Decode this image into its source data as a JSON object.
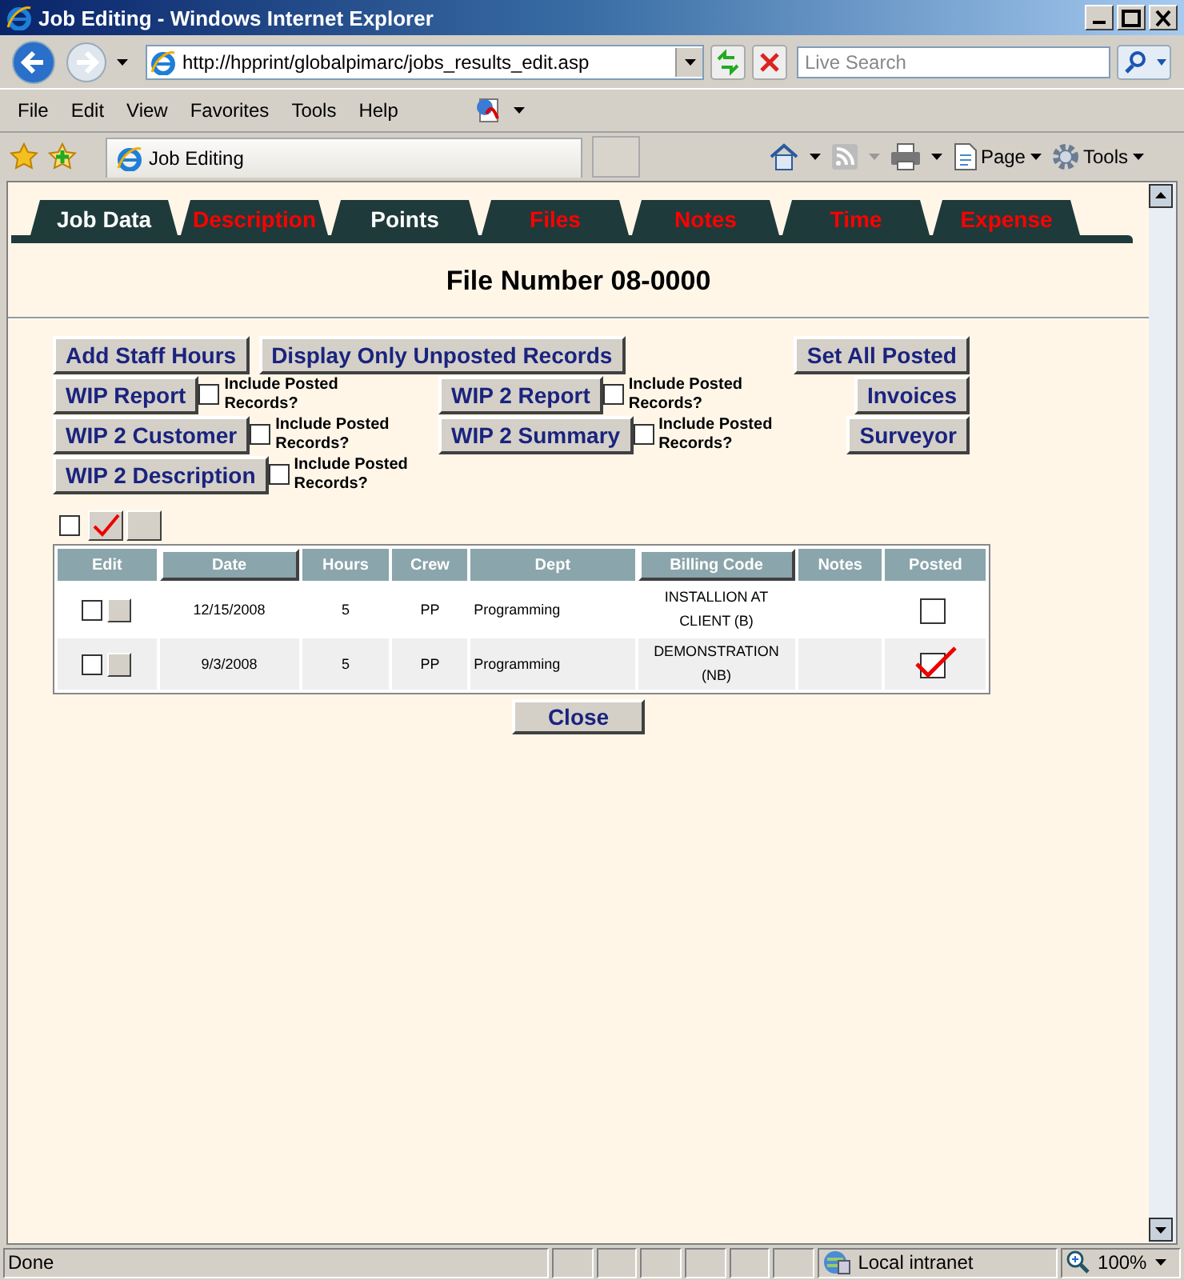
{
  "window": {
    "title": "Job Editing - Windows Internet Explorer"
  },
  "address": {
    "url": "http://hpprint/globalpimarc/jobs_results_edit.asp"
  },
  "search": {
    "placeholder": "Live Search"
  },
  "menu": [
    "File",
    "Edit",
    "View",
    "Favorites",
    "Tools",
    "Help"
  ],
  "favorites_bar": {
    "tab_title": "Job Editing",
    "page": "Page",
    "tools": "Tools"
  },
  "tabs": [
    {
      "label": "Job Data",
      "highlighted": false
    },
    {
      "label": "Description",
      "highlighted": true
    },
    {
      "label": "Points",
      "highlighted": false
    },
    {
      "label": "Files",
      "highlighted": true
    },
    {
      "label": "Notes",
      "highlighted": true
    },
    {
      "label": "Time",
      "highlighted": true
    },
    {
      "label": "Expense",
      "highlighted": true
    }
  ],
  "heading": "File Number 08-0000",
  "action_rows": [
    {
      "groups": [
        {
          "button": "Add Staff Hours"
        },
        {
          "button": "Display Only Unposted Records"
        }
      ],
      "right": "Set All Posted"
    },
    {
      "groups": [
        {
          "button": "WIP Report",
          "option": {
            "label": "Include Posted Records?",
            "checked": false
          }
        },
        {
          "button": "WIP 2 Report",
          "option": {
            "label": "Include Posted Records?",
            "checked": false
          }
        }
      ],
      "right": "Invoices"
    },
    {
      "groups": [
        {
          "button": "WIP 2 Customer",
          "option": {
            "label": "Include Posted Records?",
            "checked": false
          }
        },
        {
          "button": "WIP 2 Summary",
          "option": {
            "label": "Include Posted Records?",
            "checked": false
          }
        }
      ],
      "right": "Surveyor"
    },
    {
      "groups": [
        {
          "button": "WIP 2 Description",
          "option": {
            "label": "Include Posted Records?",
            "checked": false
          }
        }
      ]
    }
  ],
  "select_controls": [
    {
      "kind": "checkbox",
      "checked": false
    },
    {
      "kind": "button",
      "checked": true
    },
    {
      "kind": "button",
      "checked": false
    }
  ],
  "table": {
    "columns": [
      {
        "label": "Edit",
        "kind": "plain"
      },
      {
        "label": "Date",
        "kind": "sortable"
      },
      {
        "label": "Hours",
        "kind": "plain"
      },
      {
        "label": "Crew",
        "kind": "plain"
      },
      {
        "label": "Dept",
        "kind": "plain"
      },
      {
        "label": "Billing Code",
        "kind": "sortable"
      },
      {
        "label": "Notes",
        "kind": "plain"
      },
      {
        "label": "Posted",
        "kind": "plain"
      }
    ],
    "rows": [
      {
        "selected": false,
        "date": "12/15/2008",
        "hours": "5",
        "crew": "PP",
        "dept": "Programming",
        "billing_code": "INSTALLION AT CLIENT (B)",
        "posted": false
      },
      {
        "selected": false,
        "date": "9/3/2008",
        "hours": "5",
        "crew": "PP",
        "dept": "Programming",
        "billing_code": "DEMONSTRATION (NB)",
        "posted": true
      }
    ]
  },
  "close_button": "Close",
  "status_bar": {
    "text": "Done",
    "zone": "Local intranet",
    "zoom": "100%"
  }
}
